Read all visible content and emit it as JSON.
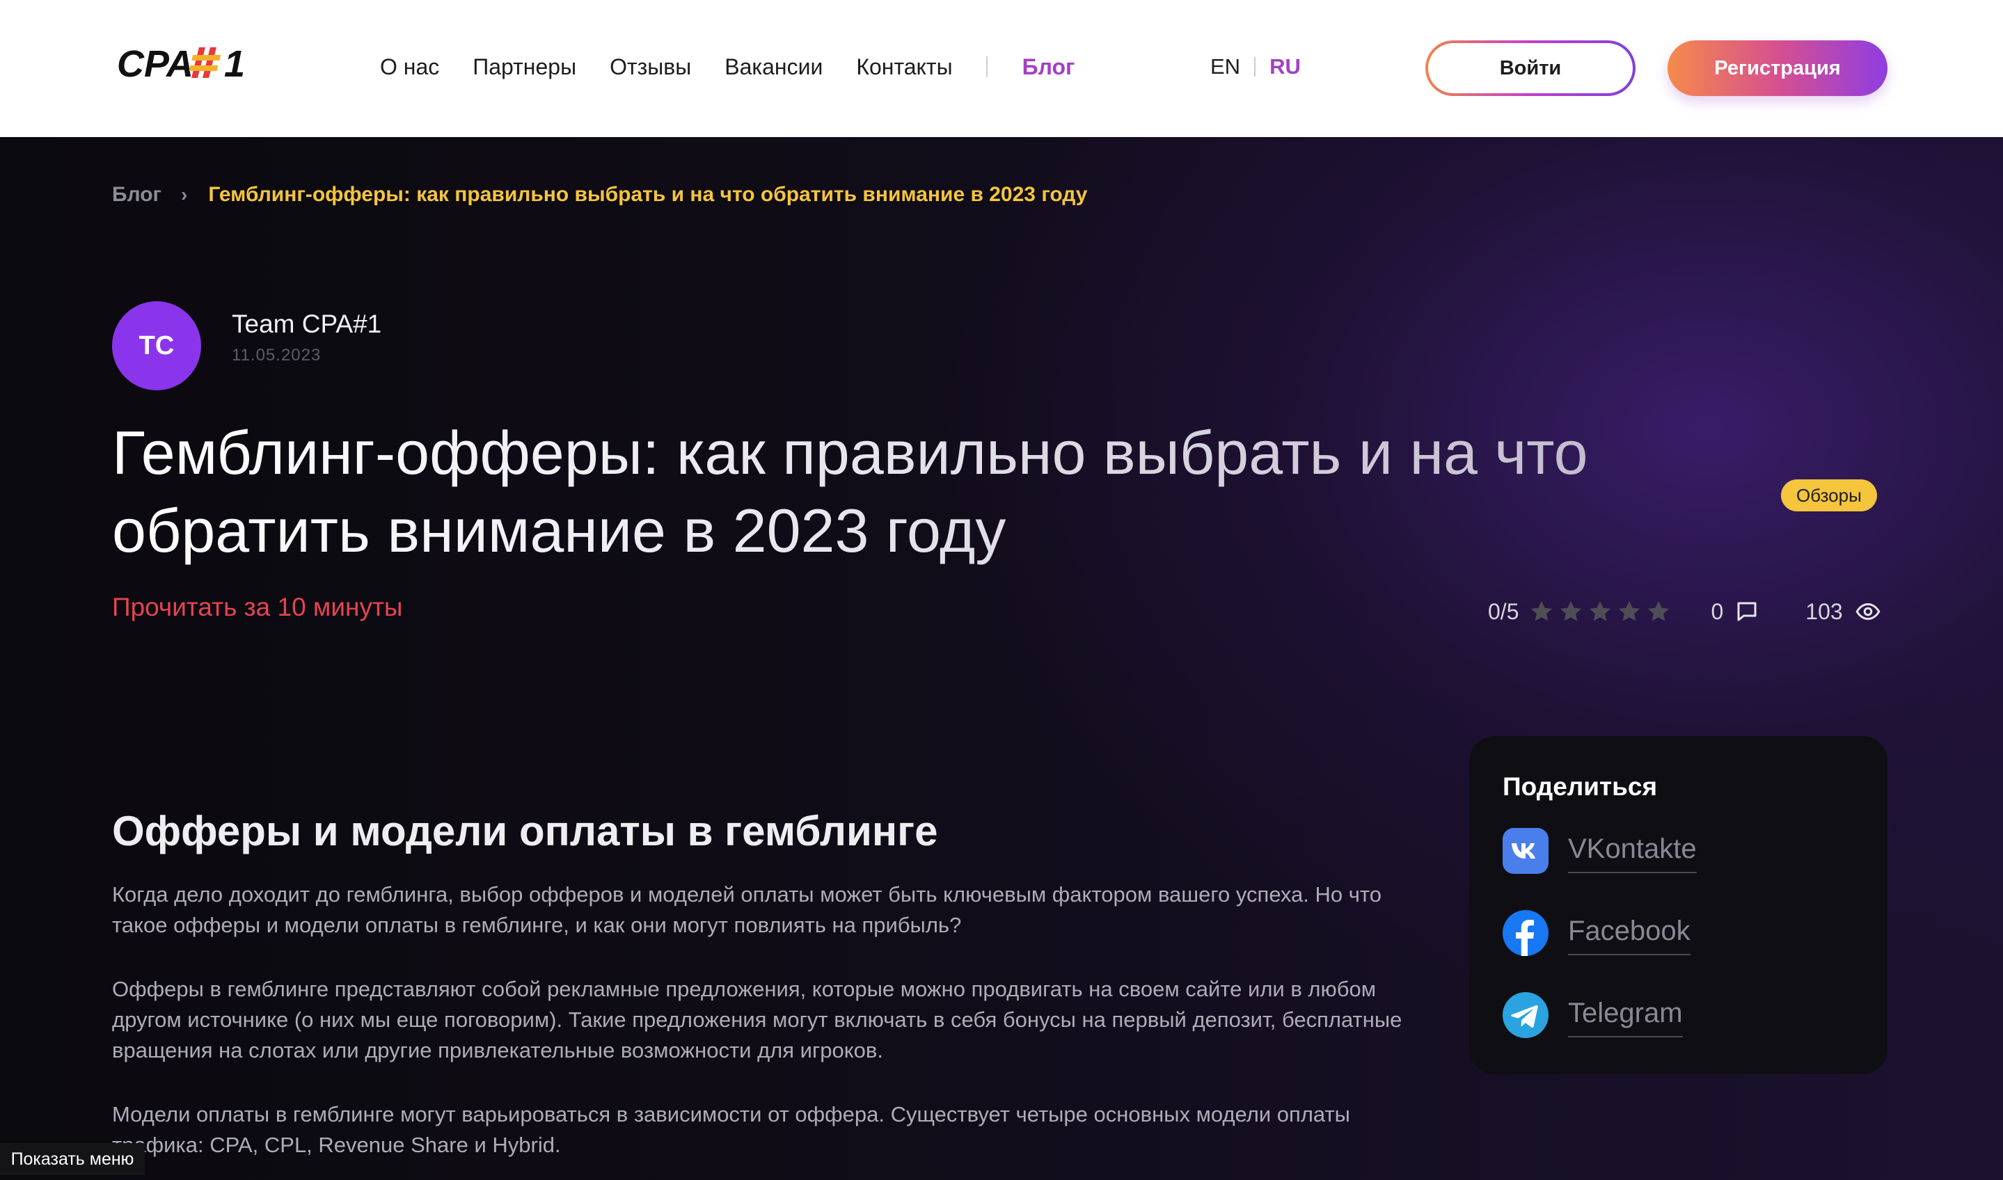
{
  "header": {
    "logo_alt": "CPA#1",
    "nav": [
      "О нас",
      "Партнеры",
      "Отзывы",
      "Вакансии",
      "Контакты"
    ],
    "blog": "Блог",
    "lang_en": "EN",
    "lang_ru": "RU",
    "login": "Войти",
    "register": "Регистрация"
  },
  "breadcrumb": {
    "root": "Блог",
    "current": "Гемблинг-офферы: как правильно выбрать и на что обратить внимание в 2023 году"
  },
  "author": {
    "initials": "TC",
    "name": "Team CPA#1",
    "date": "11.05.2023"
  },
  "article": {
    "title": "Гемблинг-офферы: как правильно выбрать и на что обратить внимание в 2023 году",
    "tag": "Обзоры",
    "read_time": "Прочитать за 10 минуты",
    "rating_text": "0/5",
    "rating_value": 0,
    "rating_max": 5,
    "comments": "0",
    "views": "103",
    "h2": "Офферы и модели оплаты в гемблинге",
    "p1": "Когда дело доходит до гемблинга, выбор офферов и моделей оплаты может быть ключевым фактором вашего успеха. Но что такое офферы и модели оплаты в гемблинге, и как они могут повлиять на прибыль?",
    "p2": "Офферы в гемблинге представляют собой рекламные предложения, которые можно продвигать на своем сайте или в любом другом источнике (о них мы еще поговорим). Такие предложения могут включать в себя бонусы на первый депозит, бесплатные вращения на слотах или другие привлекательные возможности для игроков.",
    "p3": "Модели оплаты в гемблинге могут варьироваться в зависимости от оффера. Существует четыре основных модели оплаты трафика: CPA, CPL, Revenue Share и Hybrid."
  },
  "share": {
    "title": "Поделиться",
    "items": [
      {
        "label": "VKontakte",
        "icon": "vk-icon",
        "color": "#4a7eea"
      },
      {
        "label": "Facebook",
        "icon": "facebook-icon",
        "color": "#1877f2"
      },
      {
        "label": "Telegram",
        "icon": "telegram-icon",
        "color": "#2aa3e0"
      }
    ]
  },
  "menu_tip": "Показать меню",
  "colors": {
    "accent_purple": "#a23fc6",
    "accent_yellow": "#f4c53d",
    "accent_red": "#e44452",
    "avatar": "#8a35ec"
  }
}
